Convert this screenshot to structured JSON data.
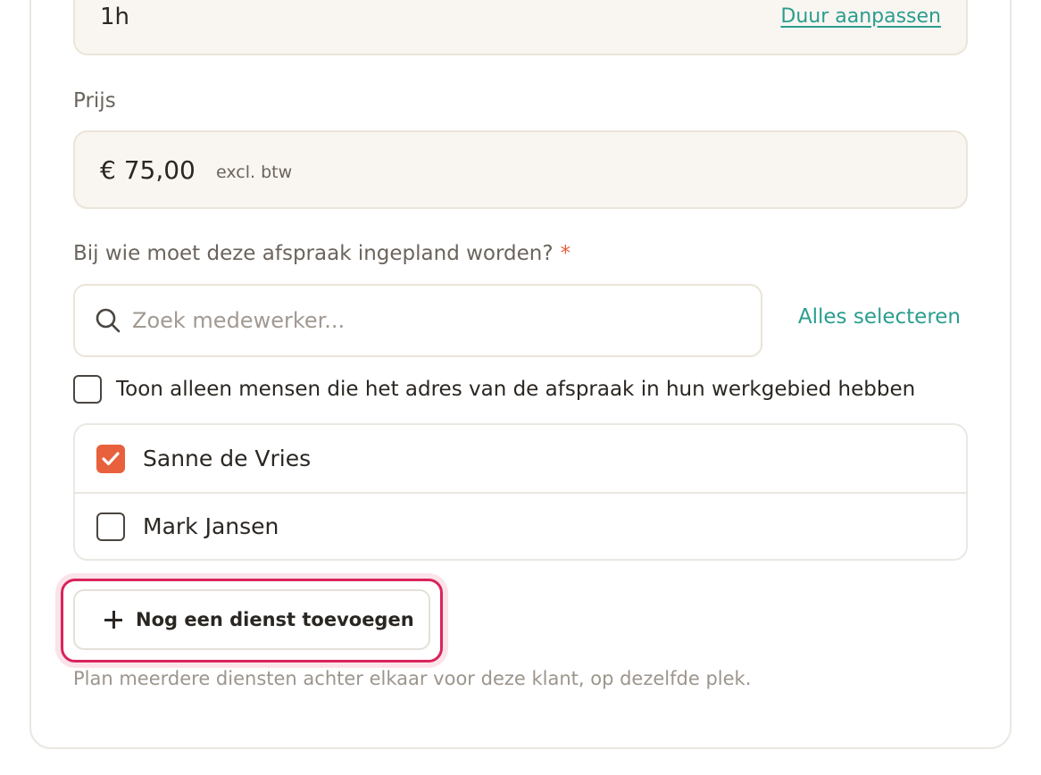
{
  "duration": {
    "value": "1h",
    "edit_link": "Duur aanpassen"
  },
  "price": {
    "label": "Prijs",
    "amount": "€ 75,00",
    "suffix": "excl. btw"
  },
  "assignment": {
    "label": "Bij wie moet deze afspraak ingepland worden?",
    "required_mark": "*",
    "search_placeholder": "Zoek medewerker...",
    "select_all": "Alles selecteren",
    "filter_label": "Toon alleen mensen die het adres van de afspraak in hun werkgebied hebben",
    "filter_checked": false,
    "staff": [
      {
        "name": "Sanne de Vries",
        "checked": true
      },
      {
        "name": "Mark Jansen",
        "checked": false
      }
    ]
  },
  "add_service": {
    "button_label": "Nog een dienst toevoegen",
    "hint": "Plan meerdere diensten achter elkaar voor deze klant, op dezelfde plek."
  },
  "colors": {
    "accent": "#e8603c",
    "link": "#2a9d8f",
    "focus": "#d9245c"
  },
  "icons": {
    "search": "search-icon",
    "check": "checkmark-icon",
    "plus": "plus-icon"
  }
}
